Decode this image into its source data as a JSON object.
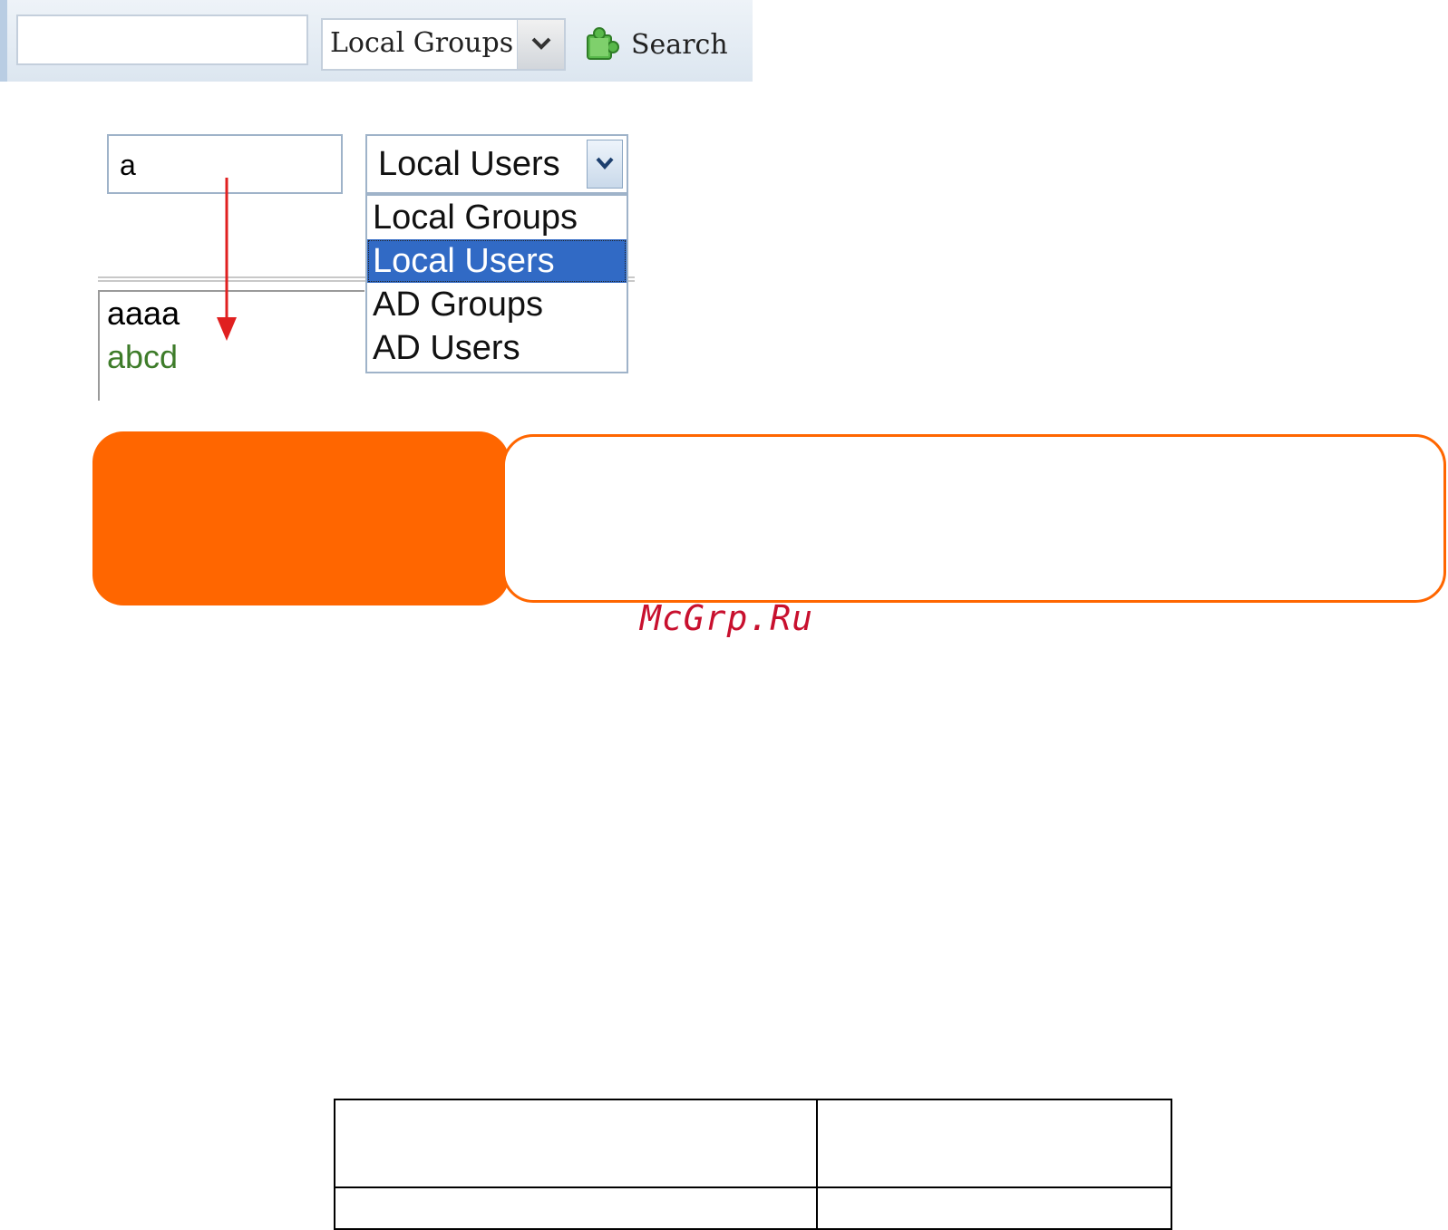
{
  "toolbar": {
    "search_value": "",
    "type_select_value": "Local Groups",
    "search_label": "Search",
    "search_icon": "puzzle-icon",
    "dropdown_icon": "chevron-down-icon"
  },
  "demo": {
    "input_value": "a",
    "select_value": "Local Users",
    "options": [
      "Local Groups",
      "Local Users",
      "AD Groups",
      "AD Users"
    ],
    "selected_index": 1,
    "selected_color": "#316ac5",
    "results": [
      "aaaa",
      "abcd"
    ],
    "arrow_color": "#e02020"
  },
  "note": {
    "accent_color": "#ff6600"
  },
  "watermark": "McGrp.Ru",
  "table": {
    "rows": [
      [
        "",
        ""
      ],
      [
        "",
        ""
      ]
    ]
  }
}
